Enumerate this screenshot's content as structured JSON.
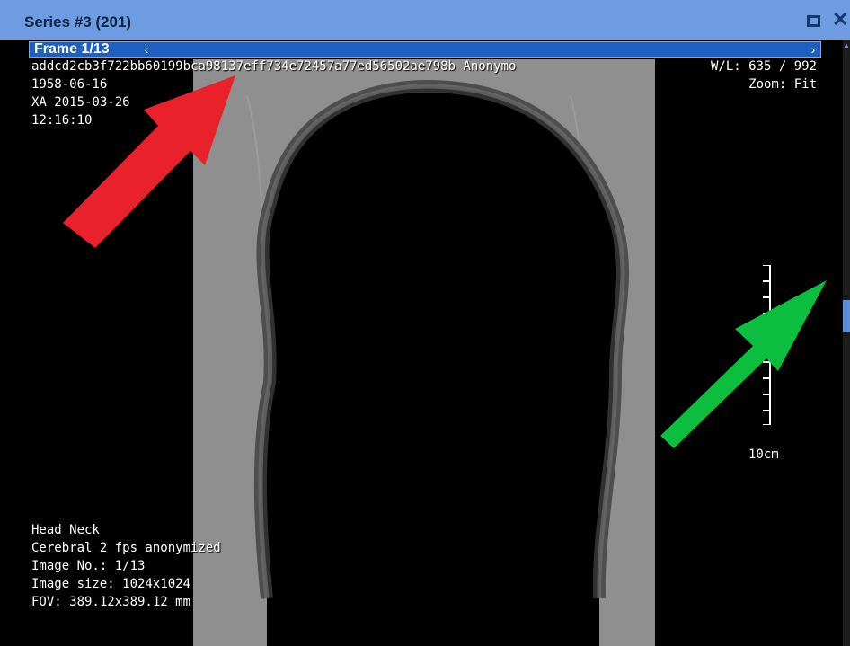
{
  "window": {
    "title": "Series #3 (201)"
  },
  "frame": {
    "label": "Frame 1/13",
    "prev_icon": "chevron-left-icon",
    "next_icon": "chevron-right-icon"
  },
  "overlay": {
    "top_left": {
      "patient_hash": "addcd2cb3f722bb60199bca98137eff734e72457a77ed56502ae798b Anonymo",
      "birth_date": "1958-06-16",
      "study": "XA 2015-03-26",
      "time": "12:16:10"
    },
    "top_right": {
      "window_level": "W/L: 635 / 992",
      "zoom": "Zoom: Fit"
    },
    "scale_label": "10cm",
    "bottom_left": {
      "line1": "Head Neck",
      "line2": "Cerebral 2 fps anonymized",
      "line3": "Image No.: 1/13",
      "line4": "Image size: 1024x1024",
      "line5": "FOV: 389.12x389.12 mm"
    }
  },
  "annotations": {
    "arrow_red_color": "#e8212a",
    "arrow_green_color": "#0bbe3d"
  },
  "colors": {
    "title_bar": "#6d9ce3",
    "frame_bar": "#1f5fbf"
  }
}
